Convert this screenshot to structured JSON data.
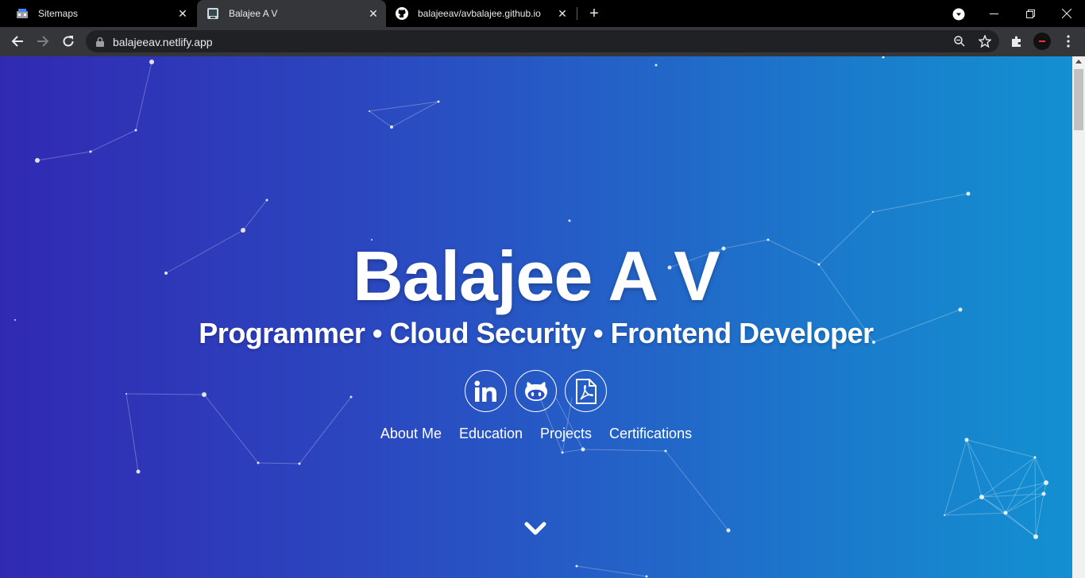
{
  "browser": {
    "tabs": [
      {
        "title": "Sitemaps",
        "icon": "sitemaps-favicon",
        "active": false
      },
      {
        "title": "Balajee A V",
        "icon": "site-favicon",
        "active": true
      },
      {
        "title": "balajeeav/avbalajee.github.io",
        "icon": "github-icon",
        "active": false
      }
    ],
    "url": "balajeeav.netlify.app"
  },
  "hero": {
    "name": "Balajee A V",
    "subtitle": "Programmer • Cloud Security • Frontend Developer"
  },
  "socials": [
    {
      "name": "linkedin",
      "icon": "linkedin-icon"
    },
    {
      "name": "github",
      "icon": "github-icon"
    },
    {
      "name": "resume-pdf",
      "icon": "pdf-icon"
    }
  ],
  "menu": [
    "About Me",
    "Education",
    "Projects",
    "Certifications"
  ],
  "colors": {
    "gradient_start": "#3129b2",
    "gradient_end": "#1390d1",
    "chrome_bg": "#000000",
    "toolbar_bg": "#35363a"
  }
}
